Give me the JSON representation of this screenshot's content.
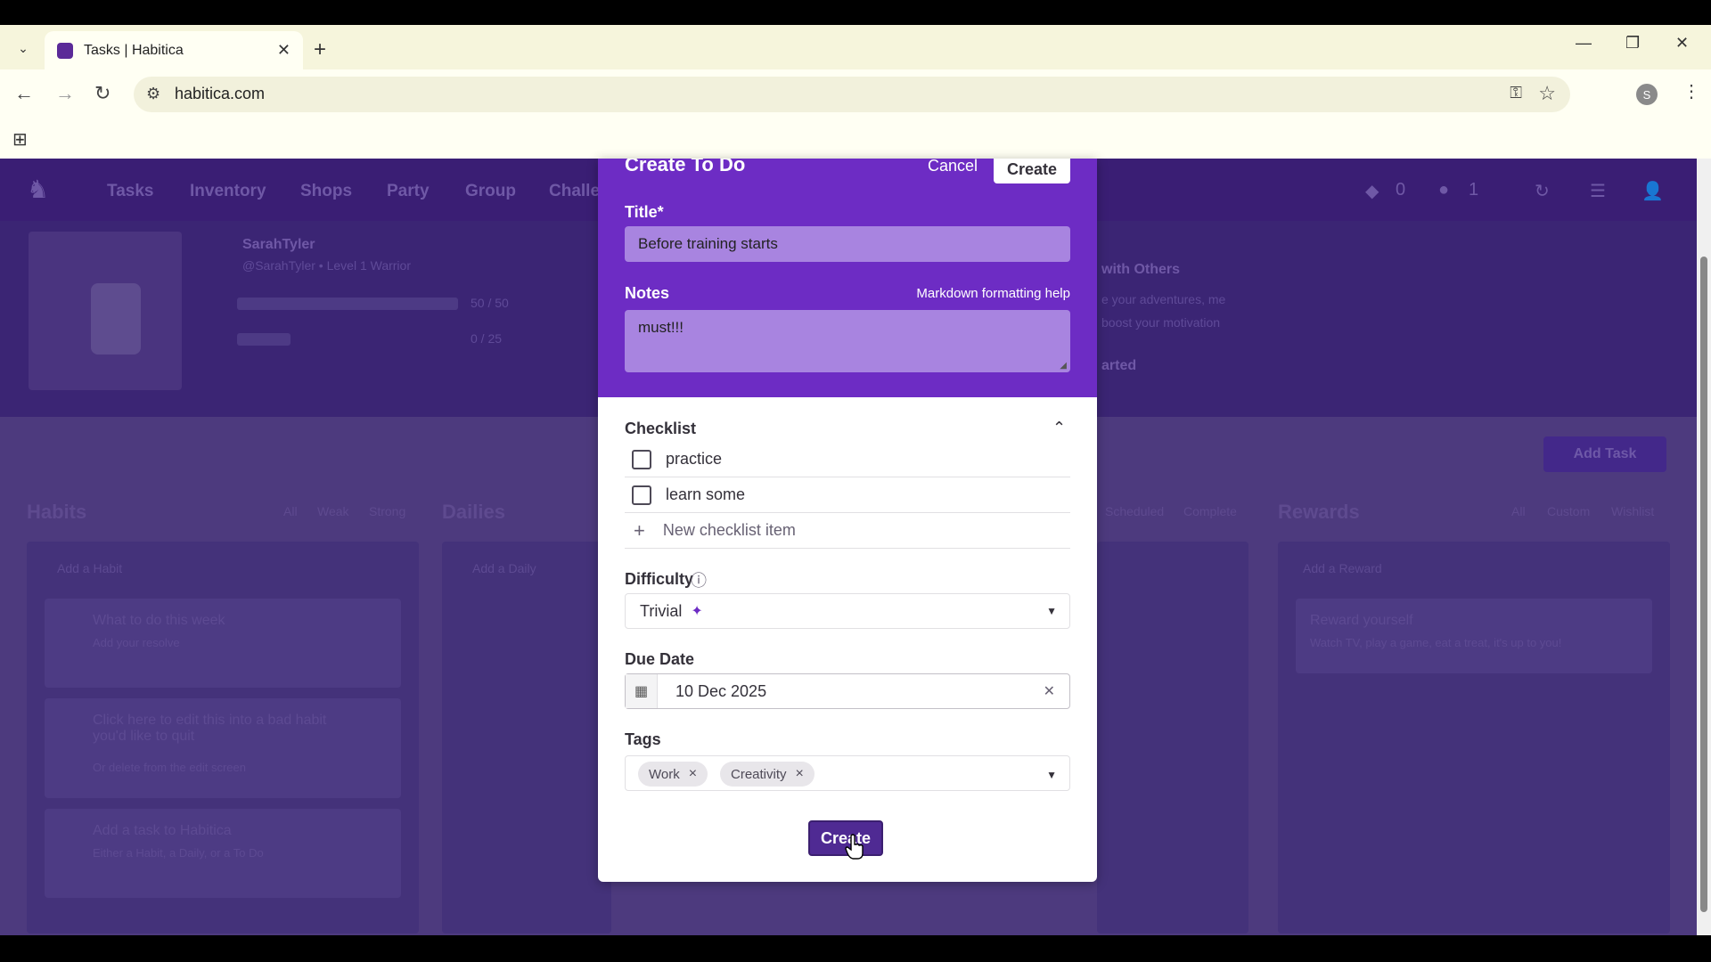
{
  "browser": {
    "tab_title": "Tasks | Habitica",
    "url": "habitica.com",
    "profile_initial": "S"
  },
  "page": {
    "nav": [
      "Tasks",
      "Inventory",
      "Shops",
      "Party",
      "Group",
      "Challe"
    ],
    "gems": "0",
    "gold": "1",
    "user_name": "SarahTyler",
    "user_sub": "@SarahTyler • Level 1 Warrior",
    "hp": "50 / 50",
    "xp": "0 / 25",
    "social_title": "with Others",
    "social_sub1": "e your adventures, me",
    "social_sub2": "boost your motivation",
    "social_cta": "arted",
    "add_task": "Add Task",
    "sections": {
      "habits": "Habits",
      "dailies": "Dailies",
      "rewards": "Rewards"
    },
    "habit_filters": [
      "All",
      "Weak",
      "Strong"
    ],
    "reward_filters": [
      "All",
      "Custom",
      "Wishlist"
    ],
    "daily_filters": [
      "Scheduled",
      "Complete"
    ],
    "habit_add": "Add a Habit",
    "daily_add": "Add a Daily",
    "reward_add": "Add a Reward",
    "habit_cards": [
      {
        "title": "What to do this week",
        "sub": "Add your resolve"
      },
      {
        "title": "Click here to edit this into a bad habit you'd like to quit",
        "sub": "Or delete from the edit screen"
      },
      {
        "title": "Add a task to Habitica",
        "sub": "Either a Habit, a Daily, or a To Do"
      }
    ],
    "reward_card": {
      "title": "Reward yourself",
      "sub": "Watch TV, play a game, eat a treat, it's up to you!"
    }
  },
  "modal": {
    "heading": "Create To Do",
    "cancel": "Cancel",
    "create_top": "Create",
    "title_label": "Title*",
    "title_value": "Before training starts",
    "notes_label": "Notes",
    "markdown_help": "Markdown formatting help",
    "notes_value": "must!!!",
    "checklist_label": "Checklist",
    "checklist": [
      "practice",
      "learn some"
    ],
    "new_item": "New checklist item",
    "difficulty_label": "Difficulty",
    "difficulty_value": "Trivial",
    "due_label": "Due Date",
    "due_value": "10 Dec 2025",
    "tags_label": "Tags",
    "tags": [
      "Work",
      "Creativity"
    ],
    "create_bottom": "Create"
  },
  "colors": {
    "modal_header": "#6d2cc4",
    "input_fill": "#a884e0",
    "create_button": "#4f2a93"
  }
}
